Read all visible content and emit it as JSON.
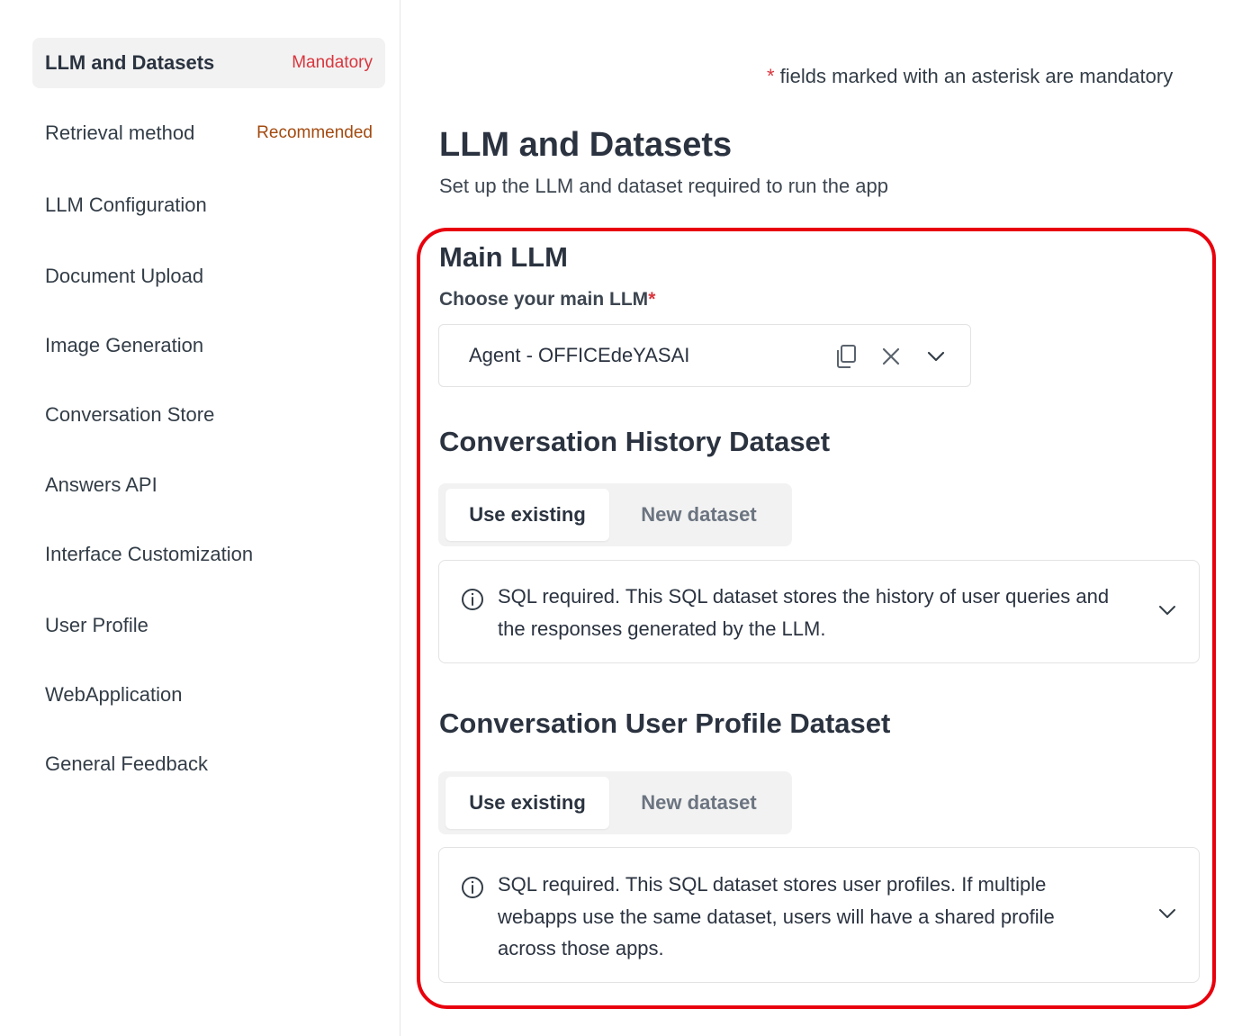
{
  "sidebar": {
    "items": [
      {
        "label": "LLM and Datasets",
        "badge": "Mandatory"
      },
      {
        "label": "Retrieval method",
        "badge": "Recommended"
      },
      {
        "label": "LLM Configuration"
      },
      {
        "label": "Document Upload"
      },
      {
        "label": "Image Generation"
      },
      {
        "label": "Conversation Store"
      },
      {
        "label": "Answers API"
      },
      {
        "label": "Interface Customization"
      },
      {
        "label": "User Profile"
      },
      {
        "label": "WebApplication"
      },
      {
        "label": "General Feedback"
      }
    ]
  },
  "main": {
    "asterisk_mark": "*",
    "asterisk_note": " fields marked with an asterisk are mandatory",
    "title": "LLM and Datasets",
    "subtitle": "Set up the LLM and dataset required to run the app",
    "main_llm": {
      "title": "Main LLM",
      "label": "Choose your main LLM",
      "required_mark": "*",
      "value": "Agent - OFFICEdeYASAI"
    },
    "history_dataset": {
      "title": "Conversation History Dataset",
      "option_existing": "Use existing",
      "option_new": "New dataset",
      "info": "SQL required. This SQL dataset stores the history of user queries and the responses generated by the LLM."
    },
    "profile_dataset": {
      "title": "Conversation User Profile Dataset",
      "option_existing": "Use existing",
      "option_new": "New dataset",
      "info": "SQL required. This SQL dataset stores user profiles. If multiple webapps use the same dataset, users will have a shared profile across those apps."
    }
  },
  "colors": {
    "highlight": "#e8000d",
    "mandatory": "#d9363e",
    "recommended": "#a34a0f"
  },
  "icons": [
    "copy-icon",
    "clear-icon",
    "chevron-down-icon",
    "info-icon"
  ]
}
